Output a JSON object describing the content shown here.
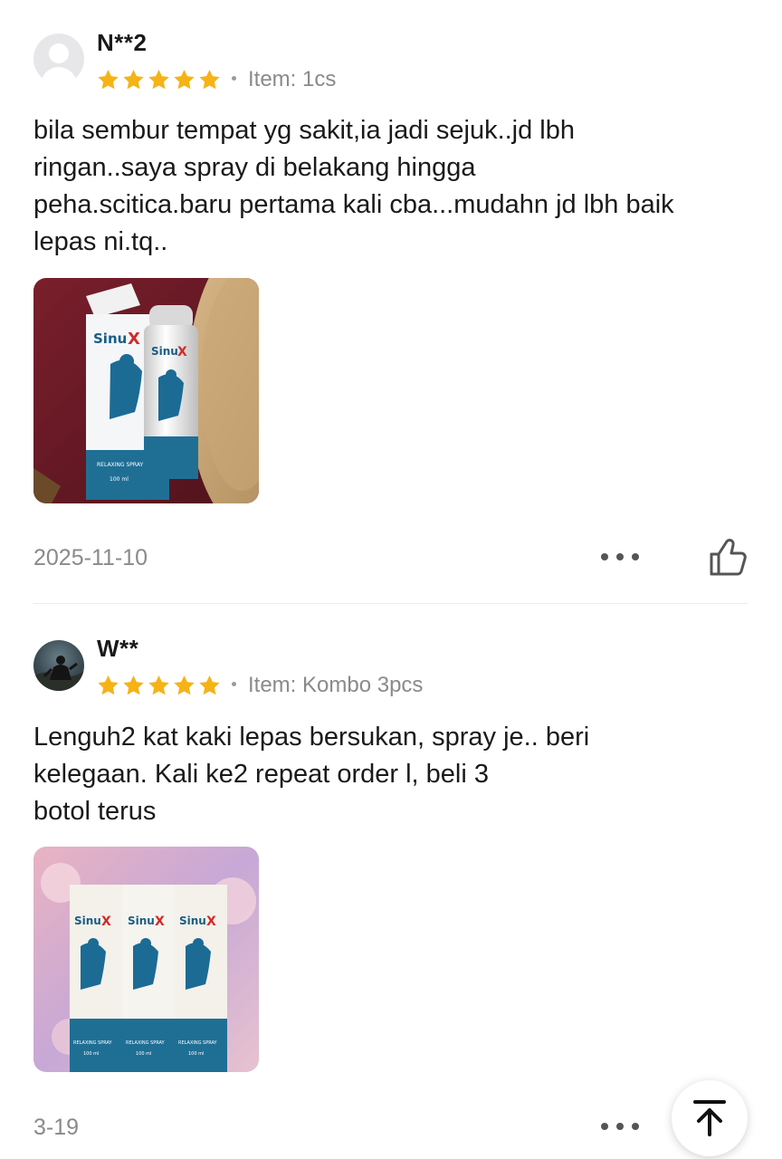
{
  "reviews": [
    {
      "username": "N**2",
      "rating": 5,
      "item": "Item: 1cs",
      "text_lines": [
        "bila sembur tempat yg sakit,ia jadi sejuk..jd lbh",
        "ringan..saya spray di belakang hingga",
        "peha.scitica.baru pertama kali cba...mudahn jd lbh baik",
        "lepas ni.tq.."
      ],
      "photo": {
        "brand": "SinuX",
        "label": "RELAXING SPRAY",
        "volume": "100 ml"
      },
      "date": "2025-11-10"
    },
    {
      "username": "W**",
      "rating": 5,
      "item": "Item: Kombo 3pcs",
      "text_lines": [
        "Lenguh2 kat kaki lepas bersukan, spray je.. beri",
        "kelegaan. Kali ke2 repeat order l, beli 3",
        "botol terus"
      ],
      "photo": {
        "brand": "SinuX",
        "label": "RELAXING SPRAY",
        "volume": "100 ml"
      },
      "date": "3-19"
    }
  ],
  "colors": {
    "star": "#f5b316",
    "text_primary": "#1a1a1a",
    "text_secondary": "#8a8a8a",
    "divider": "#ebebeb"
  },
  "icons": {
    "more": "more-horizontal-icon",
    "like": "thumbs-up-icon",
    "back_to_top": "arrow-up-to-line-icon"
  }
}
